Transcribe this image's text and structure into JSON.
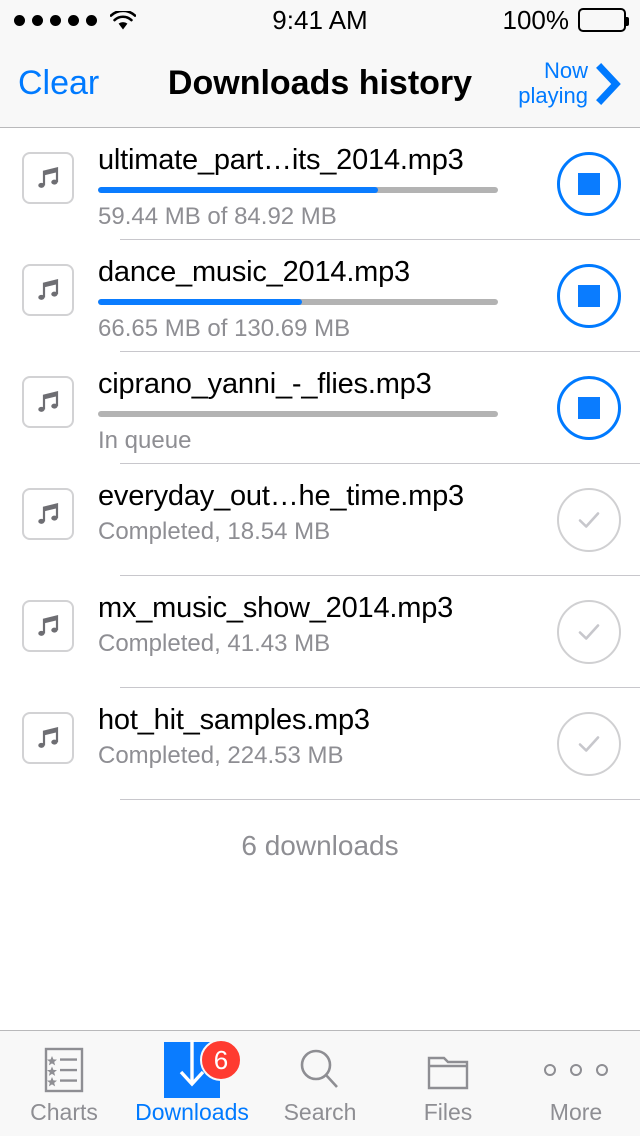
{
  "statusbar": {
    "signal_icon": "signal-dots-icon",
    "wifi_icon": "wifi-icon",
    "time": "9:41 AM",
    "battery_percent": "100%",
    "battery_icon": "battery-full-icon"
  },
  "navbar": {
    "left_button": "Clear",
    "title": "Downloads history",
    "right_line1": "Now",
    "right_line2": "playing",
    "chevron_icon": "chevron-right-icon"
  },
  "colors": {
    "accent": "#007aff",
    "progress_fill": "#0a7cff",
    "progress_track": "#b3b3b3",
    "badge": "#ff3b30",
    "secondary_text": "#8e8e93",
    "separator": "#c8c7cc"
  },
  "downloads": [
    {
      "filename": "ultimate_part…its_2014.mp3",
      "status": "59.44 MB of 84.92 MB",
      "state": "downloading",
      "progress_percent": 70,
      "downloaded_mb": "59.44",
      "total_mb": "84.92",
      "action_icon": "stop-button",
      "thumb_icon": "music-note-icon"
    },
    {
      "filename": "dance_music_2014.mp3",
      "status": "66.65 MB of 130.69 MB",
      "state": "downloading",
      "progress_percent": 51,
      "downloaded_mb": "66.65",
      "total_mb": "130.69",
      "action_icon": "stop-button",
      "thumb_icon": "music-note-icon"
    },
    {
      "filename": "ciprano_yanni_-_flies.mp3",
      "status": "In queue",
      "state": "queued",
      "progress_percent": 0,
      "action_icon": "stop-button",
      "thumb_icon": "music-note-icon"
    },
    {
      "filename": "everyday_out…he_time.mp3",
      "status": "Completed, 18.54 MB",
      "state": "completed",
      "size_mb": "18.54",
      "action_icon": "checkmark-circle-icon",
      "thumb_icon": "music-note-icon"
    },
    {
      "filename": "mx_music_show_2014.mp3",
      "status": "Completed, 41.43 MB",
      "state": "completed",
      "size_mb": "41.43",
      "action_icon": "checkmark-circle-icon",
      "thumb_icon": "music-note-icon"
    },
    {
      "filename": "hot_hit_samples.mp3",
      "status": "Completed, 224.53 MB",
      "state": "completed",
      "size_mb": "224.53",
      "action_icon": "checkmark-circle-icon",
      "thumb_icon": "music-note-icon"
    }
  ],
  "footer": {
    "count_label": "6 downloads"
  },
  "tabbar": {
    "items": [
      {
        "label": "Charts",
        "icon": "charts-list-icon",
        "active": false,
        "badge": null
      },
      {
        "label": "Downloads",
        "icon": "download-arrow-icon",
        "active": true,
        "badge": "6"
      },
      {
        "label": "Search",
        "icon": "search-icon",
        "active": false,
        "badge": null
      },
      {
        "label": "Files",
        "icon": "folder-icon",
        "active": false,
        "badge": null
      },
      {
        "label": "More",
        "icon": "ellipsis-icon",
        "active": false,
        "badge": null
      }
    ]
  }
}
